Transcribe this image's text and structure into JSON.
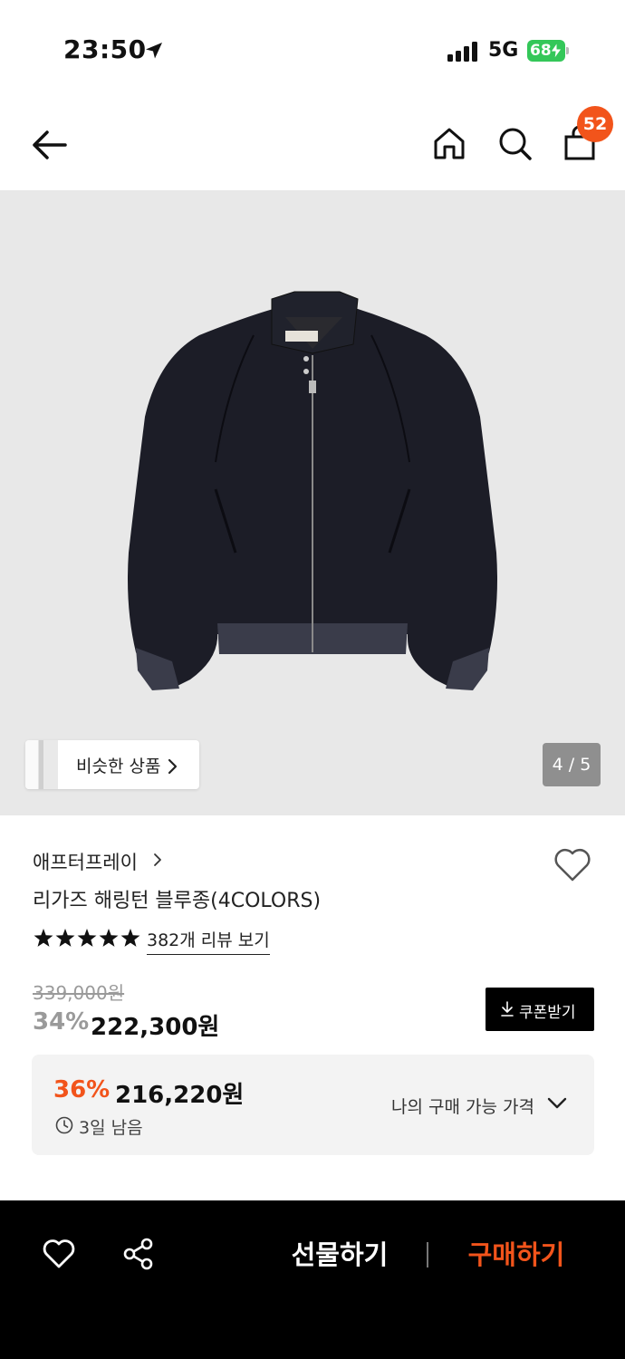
{
  "status_bar": {
    "time": "23:50",
    "network": "5G",
    "battery": "68"
  },
  "header": {
    "cart_count": "52",
    "icons": [
      "back-arrow-icon",
      "home-icon",
      "search-icon",
      "cart-icon"
    ]
  },
  "gallery": {
    "similar_label": "비슷한 상품",
    "page_indicator": "4 / 5",
    "background": "#e8e8e8"
  },
  "product": {
    "brand": "애프터프레이",
    "title": "리가즈 해링턴 블루종(4COLORS)",
    "rating_stars": 5,
    "review_link": "382개 리뷰 보기",
    "original_price": "339,000원",
    "discount_rate": "34%",
    "sale_price": "222,300원",
    "coupon_label": "쿠폰받기"
  },
  "best_price": {
    "rate": "36%",
    "price": "216,220원",
    "remaining": "3일 남음",
    "my_price_label": "나의 구매 가능 가격"
  },
  "bottom_bar": {
    "gift_label": "선물하기",
    "buy_label": "구매하기"
  },
  "colors": {
    "accent": "#f2541b",
    "battery": "#34c759",
    "bottom_bar": "#000000"
  }
}
